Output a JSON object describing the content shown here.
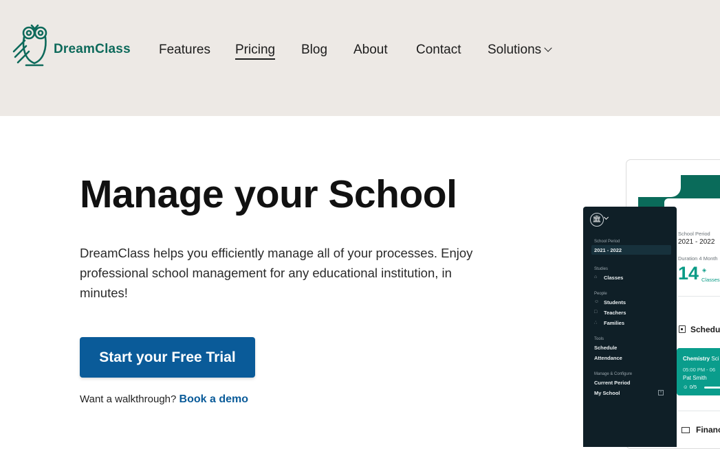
{
  "brand": {
    "name": "DreamClass",
    "color": "#0e6a5b"
  },
  "nav": {
    "items": [
      "Features",
      "Pricing",
      "Blog",
      "About",
      "Contact",
      "Solutions"
    ],
    "active": "Pricing"
  },
  "hero": {
    "title": "Manage your School",
    "description": "DreamClass helps you efficiently manage all of your processes. Enjoy professional school management for any educational institution, in minutes!",
    "cta_label": "Start your Free Trial",
    "cta_color": "#0a5b99",
    "walkthrough_text": "Want a walkthrough? ",
    "demo_link": "Book a demo"
  },
  "app_preview": {
    "sidebar": {
      "school_period_label": "School Period",
      "school_period_value": "2021 - 2022",
      "studies_label": "Studies",
      "classes": "Classes",
      "people_label": "People",
      "students": "Students",
      "teachers": "Teachers",
      "families": "Families",
      "tools_label": "Tools",
      "schedule": "Schedule",
      "attendance": "Attendance",
      "manage_label": "Manage & Configure",
      "current_period": "Current Period",
      "my_school": "My School"
    },
    "main": {
      "school_period_label": "School Period",
      "school_period_value": "2021 - 2022",
      "duration_label": "Duration 4 Month",
      "classes_count": "14",
      "classes_label": "Classes",
      "schedule_label": "Schedule",
      "card_subject": "Chemistry",
      "card_subject_extra": "Sci",
      "card_time": "05:00 PM - 06",
      "card_teacher": "Pat Smith",
      "card_count": "0/5",
      "finance_label": "Financ"
    }
  }
}
